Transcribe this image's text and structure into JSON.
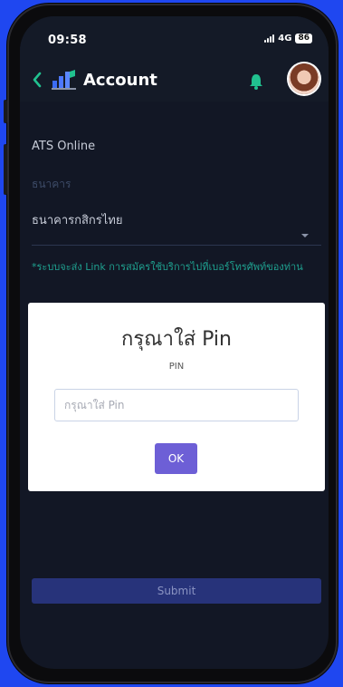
{
  "status_bar": {
    "time": "09:58",
    "network": "4G",
    "battery": "86"
  },
  "header": {
    "title": "Account",
    "icons": [
      "back-chevron-icon",
      "app-logo-icon",
      "bell-icon",
      "avatar"
    ]
  },
  "form": {
    "service_label": "ATS Online",
    "bank_label": "ธนาคาร",
    "bank_value": "ธนาคารกสิกรไทย",
    "notice": "*ระบบจะส่ง Link การสมัครใช้บริการไปที่เบอร์โทรศัพท์ของท่าน",
    "submit_label": "Submit"
  },
  "dialog": {
    "title": "กรุณาใส่ Pin",
    "field_label": "PIN",
    "input_placeholder": "กรุณาใส่ Pin",
    "input_value": "",
    "ok_label": "OK"
  },
  "colors": {
    "background": "#1f47f0",
    "screen": "#121725",
    "accent_green": "#21c18f",
    "notice_teal": "#1fa08f",
    "submit_bg": "#27337a",
    "ok_bg": "#6d5fd6"
  }
}
